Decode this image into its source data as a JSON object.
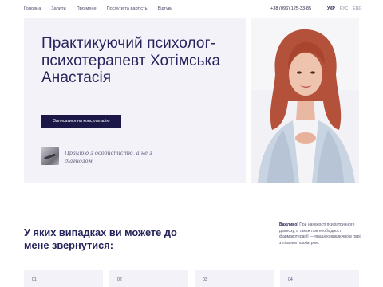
{
  "nav": {
    "links": [
      "Головна",
      "Запити",
      "Про мене",
      "Послуги та вартість",
      "Відгуки"
    ],
    "phone": "+38 (096) 125-33-85",
    "languages": [
      "УКР",
      "РУС",
      "ENG"
    ],
    "active_language": "УКР"
  },
  "hero": {
    "title": "Практикуючий психолог-психотерапевт Хотімська Анастасія",
    "cta_label": "Записатися на консультацію",
    "quote": "Працюю з особистістю, а не з діагнозом"
  },
  "section": {
    "title": "У яких випадках ви можете до мене звернутися:",
    "notice_strong": "Важливо!",
    "notice_text": " При наявності психіатричного діагнозу, а також при необхідності фармакотерапії — працюю виключно в парі з лікарем психіатром."
  },
  "cards": [
    "01",
    "02",
    "03",
    "04"
  ],
  "colors": {
    "accent": "#1b1747",
    "hero_bg": "#f3f2f9",
    "text": "#26245a"
  }
}
